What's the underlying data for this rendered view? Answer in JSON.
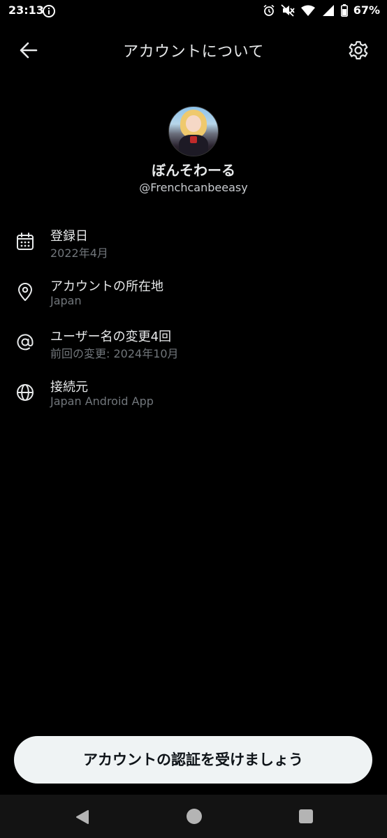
{
  "status_bar": {
    "time": "23:13",
    "battery": "67%"
  },
  "header": {
    "title": "アカウントについて",
    "back_icon": "arrow-left-icon",
    "settings_icon": "gear-icon"
  },
  "profile": {
    "display_name": "ぼんそわーる",
    "handle": "@Frenchcanbeeasy"
  },
  "info_items": [
    {
      "icon": "calendar-icon",
      "label": "登録日",
      "value": "2022年4月"
    },
    {
      "icon": "location-pin-icon",
      "label": "アカウントの所在地",
      "value": "Japan"
    },
    {
      "icon": "at-sign-icon",
      "label": "ユーザー名の変更4回",
      "value": "前回の変更: 2024年10月"
    },
    {
      "icon": "globe-icon",
      "label": "接続元",
      "value": "Japan Android App"
    }
  ],
  "verify_button": {
    "label": "アカウントの認証を受けましょう"
  },
  "colors": {
    "background": "#000000",
    "primary_text": "#e7e9ea",
    "secondary_text": "#71767b",
    "button_bg": "#eff3f4",
    "button_text": "#0f1419"
  }
}
